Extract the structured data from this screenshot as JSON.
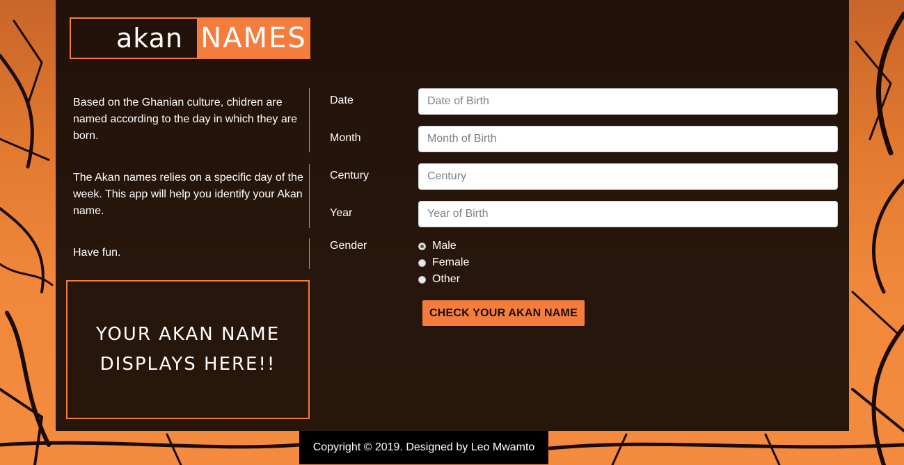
{
  "logo": {
    "left": "akan",
    "right": "NAMES"
  },
  "info": {
    "paragraphs": [
      "Based on the Ghanian culture, chidren are named according to the day in which they are born.",
      "The Akan names relies on a specific day of the week. This app will help you identify your Akan name.",
      "Have fun."
    ]
  },
  "result": {
    "text": "YOUR AKAN NAME DISPLAYS HERE!!"
  },
  "form": {
    "date": {
      "label": "Date",
      "placeholder": "Date of Birth",
      "value": ""
    },
    "month": {
      "label": "Month",
      "placeholder": "Month of Birth",
      "value": ""
    },
    "century": {
      "label": "Century",
      "placeholder": "Century",
      "value": ""
    },
    "year": {
      "label": "Year",
      "placeholder": "Year of Birth",
      "value": ""
    },
    "gender": {
      "label": "Gender",
      "options": [
        {
          "label": "Male",
          "checked": true
        },
        {
          "label": "Female",
          "checked": false
        },
        {
          "label": "Other",
          "checked": false
        }
      ]
    },
    "submit_label": "CHECK YOUR AKAN NAME"
  },
  "footer": {
    "text": "Copyright © 2019. Designed by Leo Mwamto"
  },
  "colors": {
    "accent": "#f47c3c",
    "panel": "#060303",
    "sky_top": "#c9652a",
    "sky_bottom": "#f58b3f"
  }
}
